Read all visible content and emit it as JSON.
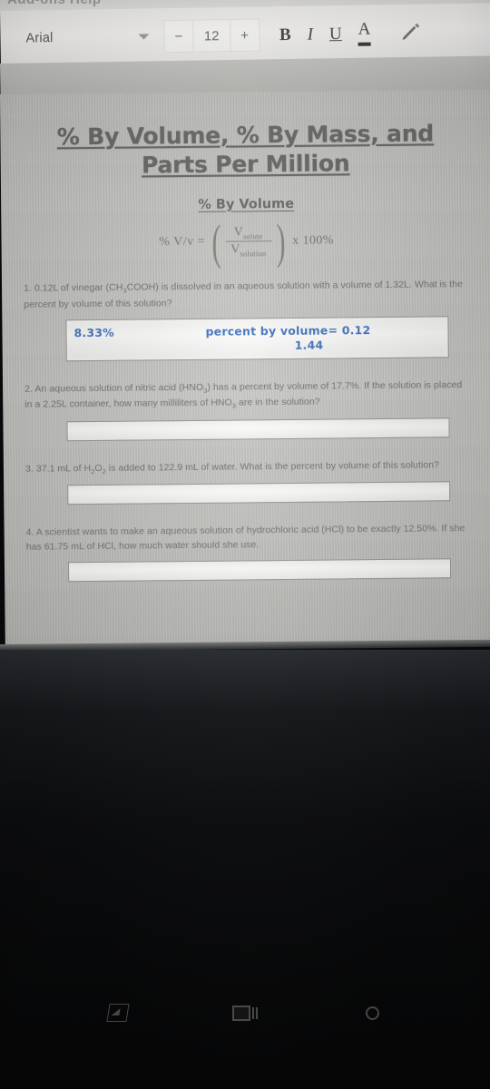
{
  "app": {
    "menu_cutoff_text": "Add-ons   Help"
  },
  "toolbar": {
    "font_name": "Arial",
    "font_size": "12",
    "decrease_label": "−",
    "increase_label": "+",
    "bold_label": "B",
    "italic_label": "I",
    "underline_label": "U",
    "text_color_label": "A",
    "highlight_icon": "pen-icon"
  },
  "document": {
    "title_line1": "% By Volume, % By Mass, and",
    "title_line2": "Parts Per Million",
    "section_heading": "% By Volume",
    "formula": {
      "lhs": "% V/v =",
      "numerator": "V",
      "numerator_sub": "solute",
      "denominator": "V",
      "denominator_sub": "solution",
      "rhs": "x 100%"
    },
    "questions": [
      {
        "number": "1.",
        "text_part1": "0.12L of vinegar (CH",
        "sub1": "3",
        "text_part2": "COOH) is dissolved in an aqueous solution with a volume of 1.32L.  What is the percent by volume of this solution?",
        "answer_value": "8.33%",
        "work_line1": "percent by volume= 0.12",
        "work_line2": "1.44",
        "answered": true
      },
      {
        "number": "2.",
        "text_part1": "An aqueous solution of nitric acid (HNO",
        "sub1": "3",
        "text_part2": ") has a percent by volume of 17.7%.  If the solution is placed in a 2.25L container, how many milliliters of HNO",
        "sub2": "3",
        "text_part3": " are in the solution?",
        "answer_value": "",
        "answered": false
      },
      {
        "number": "3.",
        "text_part1": "37.1 mL of H",
        "sub1": "2",
        "text_part2": "O",
        "sub2": "2",
        "text_part3": " is added to 122.9 mL of water.  What is the percent by volume of this solution?",
        "answer_value": "",
        "answered": false
      },
      {
        "number": "4.",
        "text_part1": "A scientist wants to make an aqueous solution of hydrochloric acid (HCl) to be exactly 12.50%.  If she has 61.75 mL of HCl, how much water should she use.",
        "answer_value": "",
        "answered": false
      }
    ]
  },
  "navbar": {
    "back_label": "back-icon",
    "home_label": "home-icon",
    "recent_label": "recent-apps-icon"
  },
  "colors": {
    "answer_blue": "#4878c0",
    "document_bg": "#c6c6c3",
    "toolbar_bg": "#f1efed"
  }
}
